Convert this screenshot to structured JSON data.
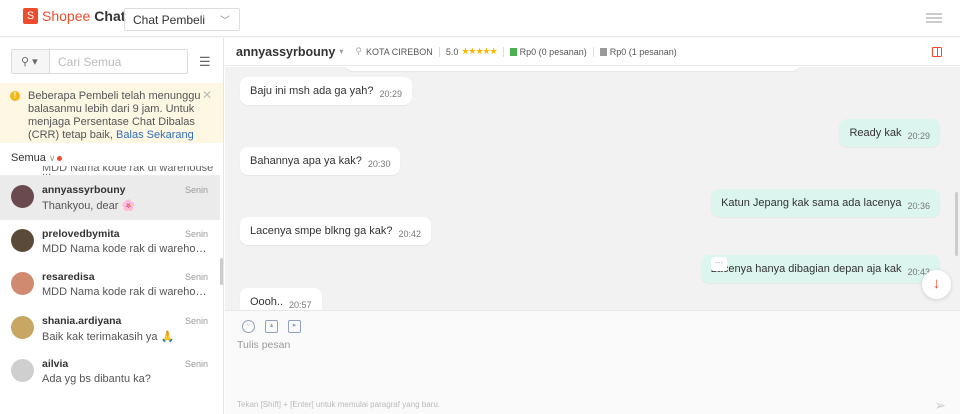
{
  "header": {
    "logo_brand": "Shopee",
    "logo_product": "Chat",
    "chat_type": "Chat Pembeli"
  },
  "sidebar": {
    "search_placeholder": "Cari Semua",
    "notice": {
      "text": "Beberapa Pembeli telah menunggu balasanmu lebih dari 9 jam. Untuk menjaga Persentase Chat Dibalas (CRR) tetap baik,",
      "link": "Balas Sekarang"
    },
    "filter": "Semua",
    "cut_preview": "MDD Nama kode rak di warehouse ...",
    "conversations": [
      {
        "name": "annyassyrbouny",
        "time": "Senin",
        "preview": "Thankyou, dear 🌸",
        "avatar": "#6b4a4f"
      },
      {
        "name": "prelovedbymita",
        "time": "Senin",
        "preview": "MDD Nama kode rak di warehouse ...",
        "avatar": "#5a4a3a"
      },
      {
        "name": "resaredisa",
        "time": "Senin",
        "preview": "MDD Nama kode rak di warehouse ...",
        "avatar": "#d08a70"
      },
      {
        "name": "shania.ardiyana",
        "time": "Senin",
        "preview": "Baik kak terimakasih ya 🙏",
        "avatar": "#c8a664"
      },
      {
        "name": "ailvia",
        "time": "Senin",
        "preview": "Ada yg bs dibantu ka?",
        "avatar": "#cfcfcf"
      }
    ]
  },
  "chat": {
    "user": "annyassyrbouny",
    "location": "KOTA CIREBON",
    "rating": "5.0",
    "stars": "★★★★★",
    "paid": "Rp0 (0 pesanan)",
    "unpaid": "Rp0 (1 pesanan)",
    "messages": [
      {
        "text": "Baju ini msh ada ga yah?",
        "time": "20:29",
        "from": "buyer"
      },
      {
        "text": "Ready kak",
        "time": "20:29",
        "from": "me"
      },
      {
        "text": "Bahannya apa ya kak?",
        "time": "20:30",
        "from": "buyer"
      },
      {
        "text": "Katun Jepang kak sama ada lacenya",
        "time": "20:36",
        "from": "me"
      },
      {
        "text": "Lacenya smpe blkng ga kak?",
        "time": "20:42",
        "from": "buyer"
      },
      {
        "text": "Lacenya hanya dibagian depan aja kak",
        "time": "20:43",
        "from": "me"
      },
      {
        "text": "Oooh..",
        "time": "20:57",
        "from": "buyer"
      }
    ],
    "composer_placeholder": "Tulis pesan",
    "hint": "Tekan [Shift] + [Enter] untuk memulai paragraf yang baru."
  }
}
